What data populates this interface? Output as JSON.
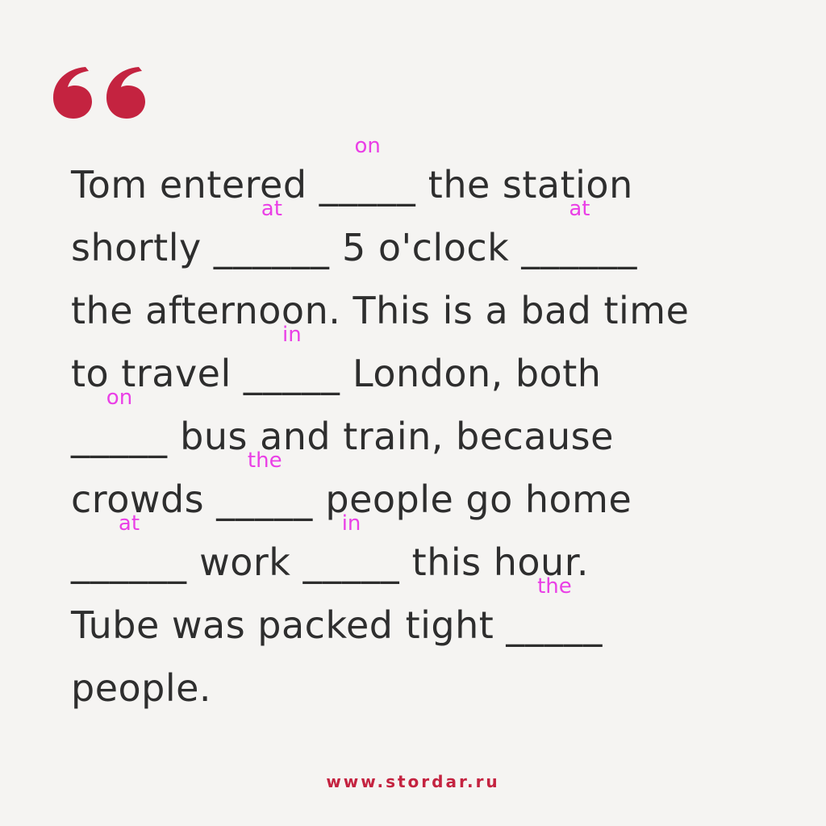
{
  "colors": {
    "background": "#f5f4f2",
    "text": "#2e2e2e",
    "answer": "#ea3fe6",
    "accent": "#c42340"
  },
  "quote_icon": "opening-double-quote-icon",
  "lines": [
    [
      {
        "t": "Tom entered "
      },
      {
        "b": "_____",
        "a": "on"
      },
      {
        "t": " the station"
      }
    ],
    [
      {
        "t": "shortly "
      },
      {
        "b": "______",
        "a": "at"
      },
      {
        "t": " 5 o'clock "
      },
      {
        "b": "______",
        "a": "at"
      }
    ],
    [
      {
        "t": "the afternoon. This is a bad time"
      }
    ],
    [
      {
        "t": "to travel "
      },
      {
        "b": "_____",
        "a": "in"
      },
      {
        "t": " London, both"
      }
    ],
    [
      {
        "b": "_____",
        "a": "on"
      },
      {
        "t": " bus and train, because"
      }
    ],
    [
      {
        "t": "crowds "
      },
      {
        "b": "_____",
        "a": "the"
      },
      {
        "t": " people go home"
      }
    ],
    [
      {
        "b": "______",
        "a": "at"
      },
      {
        "t": " work "
      },
      {
        "b": "_____",
        "a": "in"
      },
      {
        "t": " this hour."
      }
    ],
    [
      {
        "t": "Tube was packed tight "
      },
      {
        "b": "_____",
        "a": "the"
      }
    ],
    [
      {
        "t": "people."
      }
    ]
  ],
  "footer": "www.stordar.ru"
}
